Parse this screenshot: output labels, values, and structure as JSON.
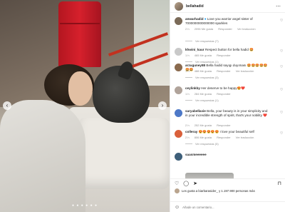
{
  "post": {
    "username": "bellahadid",
    "image_dots": "● ● ● ● ● ●"
  },
  "comments": [
    {
      "user": "anwarhadid",
      "text": "Love you warrior angel sister of 7000000000000000 sparkles",
      "time": "2 h",
      "likes": "2096 Me gusta",
      "reply": "Responder",
      "translate": "Ver traducción",
      "replies": "Ver respuestas (7)",
      "avatar_color": "#7a6a58"
    },
    {
      "user": "khwini_kaur",
      "text": "Respect button for bella hadid 🤩",
      "time": "1 h",
      "likes": "465 Me gusta",
      "reply": "Responder",
      "translate": "",
      "replies": "Ver respuestas (1)",
      "avatar_color": "#c9c9c9"
    },
    {
      "user": "arzuguney88",
      "text": "Bella hadid sayıgı duyıması 🤩🤩🤩🤩🤩🤩🤩",
      "time": "1 h",
      "likes": "488 Me gusta",
      "reply": "Responder",
      "translate": "Ver traducción",
      "replies": "Ver respuestas (3)",
      "avatar_color": "#8a6a4e"
    },
    {
      "user": "ceylinkby",
      "text": "Her deserve to be happy😍❤️",
      "time": "1 h",
      "likes": "284 Me gusta",
      "reply": "Responder",
      "translate": "",
      "replies": "Ver respuestas (1)",
      "avatar_color": "#b0a39a"
    },
    {
      "user": "saryabellavie",
      "text": "Bella, your beauty is in your simplicity and in your incredible strength of spirit, that's your nobility ❤️",
      "time": "2 h",
      "likes": "252 Me gusta",
      "reply": "Responder",
      "translate": "",
      "replies": "",
      "avatar_color": "#4d78c7"
    },
    {
      "user": "colleray",
      "text": "😍😍😍😍😍 I love your beautiful self",
      "time": "2 h",
      "likes": "806 Me gusta",
      "reply": "Responder",
      "translate": "Ver traducción",
      "replies": "Ver respuestas (5)",
      "avatar_color": "#d9603b"
    },
    {
      "user": "saasmeeeeee",
      "text": "",
      "time": "",
      "likes": "",
      "reply": "",
      "translate": "",
      "replies": "",
      "avatar_color": "#3e5f7a"
    }
  ],
  "footer": {
    "likes_text": "Les gusta a biarbarasider_ y 1.197.900 personas más",
    "date": "",
    "add_placeholder": "Añade un comentario..."
  },
  "icons": {
    "heart": "heart-icon",
    "comment": "comment-icon",
    "share": "share-icon",
    "bookmark": "bookmark-icon",
    "emoji": "emoji-icon",
    "verified": "verified-badge-icon"
  }
}
